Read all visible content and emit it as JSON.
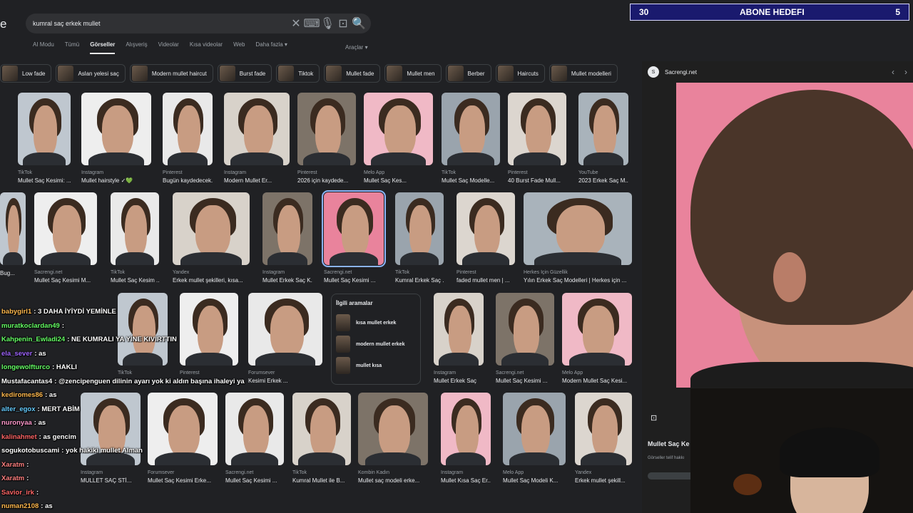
{
  "search": {
    "query": "kumral saç erkek mullet",
    "logo_fragment": "e"
  },
  "tabs": [
    "AI Modu",
    "Tümü",
    "Görseller",
    "Alışveriş",
    "Videolar",
    "Kısa videolar",
    "Web",
    "Daha fazla ▾"
  ],
  "active_tab": 2,
  "tools_label": "Araçlar ▾",
  "chips": [
    "Low fade",
    "Aslan yelesi saç",
    "Modern mullet haircut",
    "Burst fade",
    "Tiktok",
    "Mullet fade",
    "Mullet men",
    "Berber",
    "Haircuts",
    "Mullet modelleri"
  ],
  "row1": [
    {
      "src": "TikTok",
      "title": "Mullet Saç Kesimi: ..."
    },
    {
      "src": "Instagram",
      "title": "Mullet hairstyle ✓💚"
    },
    {
      "src": "Pinterest",
      "title": "Bugün kaydedecek..."
    },
    {
      "src": "Instagram",
      "title": "Modern Mullet Er..."
    },
    {
      "src": "Pinterest",
      "title": "2026 için kaydede..."
    },
    {
      "src": "Melo App",
      "title": "Mullet Saç Kes..."
    },
    {
      "src": "TikTok",
      "title": "Mullet Saç Modelle..."
    },
    {
      "src": "Pinterest",
      "title": "40 Burst Fade Mull..."
    },
    {
      "src": "YouTube",
      "title": "2023 Erkek Saç M..."
    }
  ],
  "row2": [
    {
      "src": "",
      "title": "Bug..."
    },
    {
      "src": "Sacrengi.net",
      "title": "Mullet Saç Kesimi M..."
    },
    {
      "src": "TikTok",
      "title": "Mullet Saç Kesim ..."
    },
    {
      "src": "Yandex",
      "title": "Erkek mullet şekilleri, kısa..."
    },
    {
      "src": "Instagram",
      "title": "Mullet Erkek Saç K..."
    },
    {
      "src": "Sacrengi.net",
      "title": "Mullet Saç Kesimi ..."
    },
    {
      "src": "TikTok",
      "title": "Kumral Erkek Saç ..."
    },
    {
      "src": "Pinterest",
      "title": "faded mullet men | ..."
    },
    {
      "src": "Herkes İçin Güzellik",
      "title": "Yılın Erkek Saç Modelleri | Herkes için ..."
    }
  ],
  "row3": [
    {
      "src": "TikTok",
      "title": ""
    },
    {
      "src": "Pinterest",
      "title": ""
    },
    {
      "src": "Forumsever",
      "title": "Kesimi Erkek ..."
    },
    {
      "src": "Instagram",
      "title": "Mullet Erkek Saç"
    },
    {
      "src": "Sacrengi.net",
      "title": "Mullet Saç Kesimi ..."
    },
    {
      "src": "Melo App",
      "title": "Modern Mullet Saç Kesi..."
    }
  ],
  "row4": [
    {
      "src": "Instagram",
      "title": "MULLET SAÇ STİ..."
    },
    {
      "src": "Forumsever",
      "title": "Mullet Saç Kesimi Erke..."
    },
    {
      "src": "Sacrengi.net",
      "title": "Mullet Saç Kesimi ..."
    },
    {
      "src": "TikTok",
      "title": "Kumral Mullet ile B..."
    },
    {
      "src": "Kombin Kadın",
      "title": "Mullet saç modeli erke..."
    },
    {
      "src": "Instagram",
      "title": "Mullet Kısa Saç Er..."
    },
    {
      "src": "Melo App",
      "title": "Mullet Saç Modeli K..."
    },
    {
      "src": "Yandex",
      "title": "Erkek mullet şekill..."
    }
  ],
  "related": {
    "heading": "İlgili aramalar",
    "items": [
      "kısa mullet erkek",
      "modern mullet erkek",
      "mullet kısa"
    ]
  },
  "panel": {
    "site": "Sacrengi.net",
    "title": "Mullet Saç Ke",
    "subtitle": "Görseller telif hakkı"
  },
  "goal": {
    "left": "30",
    "label": "ABONE HEDEFI",
    "right": "5"
  },
  "chat": [
    {
      "user": "babygirl1",
      "color": "#ffb84d",
      "msg": "3 DAHA İYİYDİ YEMİNLE"
    },
    {
      "user": "muratkoclardan49",
      "color": "#66ff66",
      "msg": ""
    },
    {
      "user": "Kahpenin_Ewladi24",
      "color": "#66ff66",
      "msg": "NE KUMRALI YA YİNE KIVIRTTIN"
    },
    {
      "user": "ela_sever",
      "color": "#a066ff",
      "msg": "as"
    },
    {
      "user": "longewolfturco",
      "color": "#66ff66",
      "msg": "HAKLI"
    },
    {
      "user": "Mustafacantas4",
      "color": "#ffffff",
      "msg": "@zencipenguen dilinin ayarı yok ki aldın başına ihaleyi ya"
    },
    {
      "user": "kediromes86",
      "color": "#ffb84d",
      "msg": "as"
    },
    {
      "user": "alter_egox",
      "color": "#66ccff",
      "msg": "MERT ABİM"
    },
    {
      "user": "nuronyaa",
      "color": "#ff99cc",
      "msg": "as"
    },
    {
      "user": "kalinahmet",
      "color": "#ff6666",
      "msg": "as gencim"
    },
    {
      "user": "sogukotobuscami",
      "color": "#ffffff",
      "msg": "yok hakiki mullet Alman"
    },
    {
      "user": "Xaratm",
      "color": "#ff8080",
      "msg": ""
    },
    {
      "user": "Xaratm",
      "color": "#ff8080",
      "msg": ""
    },
    {
      "user": "Savior_irk",
      "color": "#ff6666",
      "msg": ""
    },
    {
      "user": "numan2108",
      "color": "#ffb84d",
      "msg": "as"
    }
  ]
}
